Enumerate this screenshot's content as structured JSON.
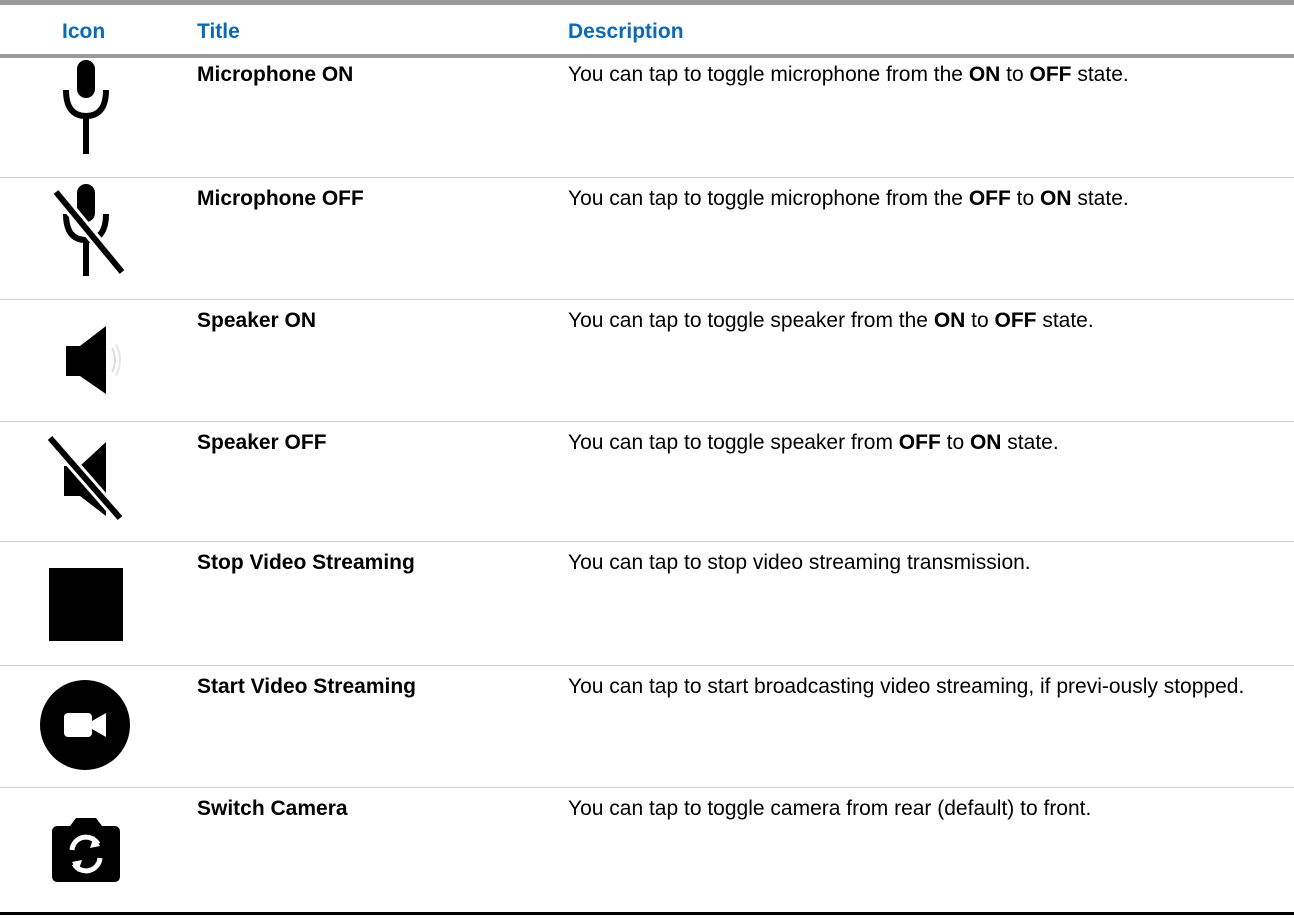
{
  "table": {
    "headers": {
      "icon": "Icon",
      "title": "Title",
      "description": "Description"
    },
    "rows": [
      {
        "icon": "microphone-on-icon",
        "title": "Microphone ON",
        "desc_pre": "You can tap to toggle microphone from the ",
        "desc_b1": "ON",
        "desc_mid": " to ",
        "desc_b2": "OFF",
        "desc_post": " state."
      },
      {
        "icon": "microphone-off-icon",
        "title": "Microphone OFF",
        "desc_pre": "You can tap to toggle microphone from the ",
        "desc_b1": "OFF",
        "desc_mid": " to ",
        "desc_b2": "ON",
        "desc_post": " state."
      },
      {
        "icon": "speaker-on-icon",
        "title": "Speaker ON",
        "desc_pre": "You can tap to toggle speaker from the ",
        "desc_b1": "ON",
        "desc_mid": " to ",
        "desc_b2": "OFF",
        "desc_post": " state."
      },
      {
        "icon": "speaker-off-icon",
        "title": "Speaker OFF",
        "desc_pre": "You can tap to toggle speaker from ",
        "desc_b1": "OFF",
        "desc_mid": " to ",
        "desc_b2": "ON",
        "desc_post": " state."
      },
      {
        "icon": "stop-square-icon",
        "title": "Stop Video Streaming",
        "desc_pre": "You can tap to stop video streaming transmission.",
        "desc_b1": "",
        "desc_mid": "",
        "desc_b2": "",
        "desc_post": ""
      },
      {
        "icon": "video-camera-circle-icon",
        "title": "Start Video Streaming",
        "desc_pre": "You can tap to start broadcasting video streaming, if previ-ously stopped.",
        "desc_b1": "",
        "desc_mid": "",
        "desc_b2": "",
        "desc_post": ""
      },
      {
        "icon": "switch-camera-icon",
        "title": "Switch Camera",
        "desc_pre": "You can tap to toggle camera from rear (default) to front.",
        "desc_b1": "",
        "desc_mid": "",
        "desc_b2": "",
        "desc_post": ""
      }
    ]
  }
}
